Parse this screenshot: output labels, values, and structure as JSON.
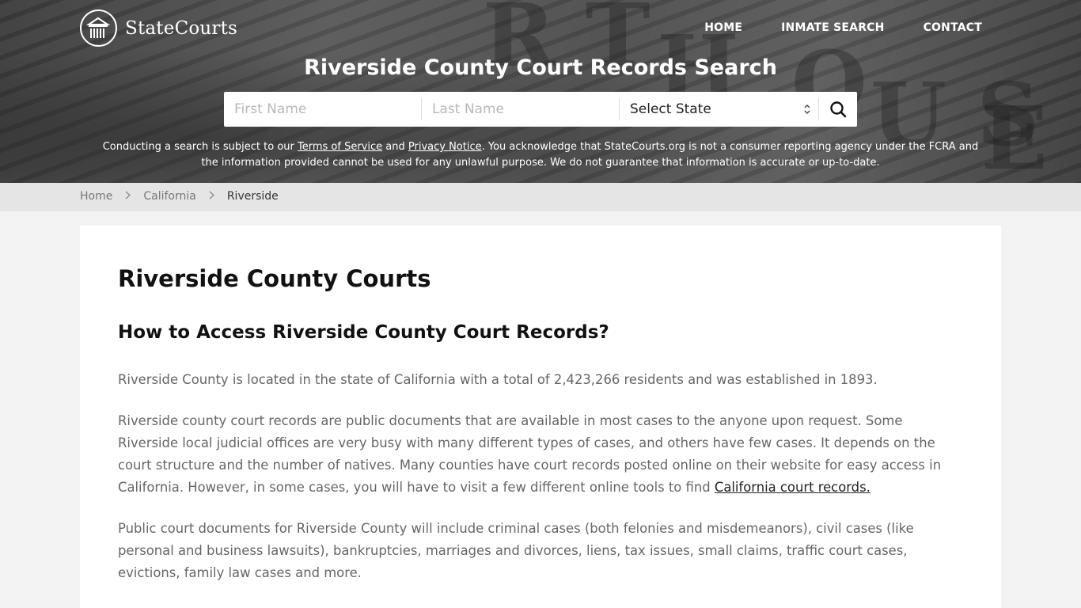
{
  "brand": {
    "name": "StateCourts",
    "logo_icon": "courthouse-columns-icon"
  },
  "nav": {
    "items": [
      "HOME",
      "INMATE SEARCH",
      "CONTACT"
    ]
  },
  "hero": {
    "title": "Riverside County Court Records Search",
    "search": {
      "first_name_placeholder": "First Name",
      "last_name_placeholder": "Last Name",
      "state_selected": "Select State",
      "search_icon": "magnifier-icon"
    },
    "disclaimer": {
      "before_terms": "Conducting a search is subject to our ",
      "terms_link": "Terms of Service",
      "between": " and ",
      "privacy_link": "Privacy Notice",
      "after": ". You acknowledge that StateCourts.org is not a consumer reporting agency under the FCRA and the information provided cannot be used for any unlawful purpose. We do not guarantee that information is accurate or up-to-date."
    }
  },
  "breadcrumb": {
    "items": [
      "Home",
      "California"
    ],
    "current": "Riverside"
  },
  "main": {
    "title": "Riverside County Courts",
    "subtitle": "How to Access Riverside County Court Records?",
    "p1": "Riverside County is located in the state of California with a total of 2,423,266 residents and was established in 1893.",
    "p2_text": "Riverside county court records are public documents that are available in most cases to the anyone upon request. Some Riverside local judicial offices are very busy with many different types of cases, and others have few cases. It depends on the court structure and the number of natives. Many counties have court records posted online on their website for easy access in California. However, in some cases, you will have to visit a few different online tools to find ",
    "p2_link": "California court records.",
    "p3": "Public court documents for Riverside County will include criminal cases (both felonies and misdemeanors), civil cases (like personal and business lawsuits), bankruptcies, marriages and divorces, liens, tax issues, small claims, traffic court cases, evictions, family law cases and more."
  },
  "colors": {
    "hero_overlay": "#4f4f4f",
    "breadcrumb_bg": "#e5e5e5",
    "page_bg": "#f3f3f3",
    "heading": "#111111",
    "body_text": "#666666"
  }
}
